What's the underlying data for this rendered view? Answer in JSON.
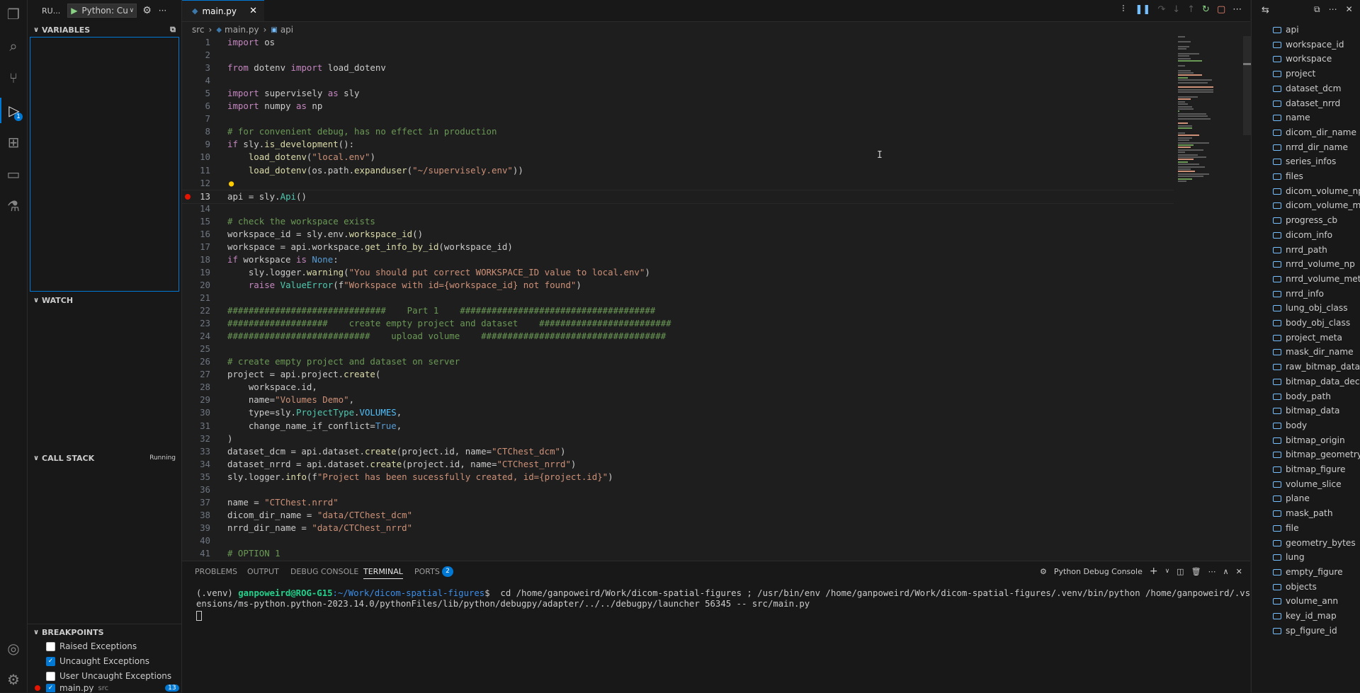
{
  "sidebar": {
    "run_label": "RU...",
    "config_label": "Python: Cu",
    "more": "···",
    "sections": {
      "variables": "VARIABLES",
      "watch": "WATCH",
      "call_stack": "CALL STACK",
      "call_stack_status": "Running",
      "breakpoints": "BREAKPOINTS"
    },
    "breakpoints": [
      {
        "label": "Raised Exceptions",
        "checked": false
      },
      {
        "label": "Uncaught Exceptions",
        "checked": true
      },
      {
        "label": "User Uncaught Exceptions",
        "checked": false
      }
    ],
    "bp_file": {
      "label": "main.py",
      "dir": "src",
      "line": "13"
    }
  },
  "activity": {
    "debug_badge": "1"
  },
  "editor": {
    "tab_label": "main.py",
    "breadcrumb": {
      "folder": "src",
      "file": "main.py",
      "symbol": "api"
    }
  },
  "code_lines": [
    {
      "n": "1",
      "t": "import os"
    },
    {
      "n": "2",
      "t": ""
    },
    {
      "n": "3",
      "t": "from dotenv import load_dotenv"
    },
    {
      "n": "4",
      "t": ""
    },
    {
      "n": "5",
      "t": "import supervisely as sly"
    },
    {
      "n": "6",
      "t": "import numpy as np"
    },
    {
      "n": "7",
      "t": ""
    },
    {
      "n": "8",
      "t": "# for convenient debug, has no effect in production"
    },
    {
      "n": "9",
      "t": "if sly.is_development():"
    },
    {
      "n": "10",
      "t": "    load_dotenv(\"local.env\")"
    },
    {
      "n": "11",
      "t": "    load_dotenv(os.path.expanduser(\"~/supervisely.env\"))"
    },
    {
      "n": "12",
      "t": ""
    },
    {
      "n": "13",
      "t": "api = sly.Api()"
    },
    {
      "n": "14",
      "t": ""
    },
    {
      "n": "15",
      "t": "# check the workspace exists"
    },
    {
      "n": "16",
      "t": "workspace_id = sly.env.workspace_id()"
    },
    {
      "n": "17",
      "t": "workspace = api.workspace.get_info_by_id(workspace_id)"
    },
    {
      "n": "18",
      "t": "if workspace is None:"
    },
    {
      "n": "19",
      "t": "    sly.logger.warning(\"You should put correct WORKSPACE_ID value to local.env\")"
    },
    {
      "n": "20",
      "t": "    raise ValueError(f\"Workspace with id={workspace_id} not found\")"
    },
    {
      "n": "21",
      "t": ""
    },
    {
      "n": "22",
      "t": "##############################    Part 1    #####################################"
    },
    {
      "n": "23",
      "t": "###################    create empty project and dataset    #########################"
    },
    {
      "n": "24",
      "t": "###########################    upload volume    ###################################"
    },
    {
      "n": "25",
      "t": ""
    },
    {
      "n": "26",
      "t": "# create empty project and dataset on server"
    },
    {
      "n": "27",
      "t": "project = api.project.create("
    },
    {
      "n": "28",
      "t": "    workspace.id,"
    },
    {
      "n": "29",
      "t": "    name=\"Volumes Demo\","
    },
    {
      "n": "30",
      "t": "    type=sly.ProjectType.VOLUMES,"
    },
    {
      "n": "31",
      "t": "    change_name_if_conflict=True,"
    },
    {
      "n": "32",
      "t": ")"
    },
    {
      "n": "33",
      "t": "dataset_dcm = api.dataset.create(project.id, name=\"CTChest_dcm\")"
    },
    {
      "n": "34",
      "t": "dataset_nrrd = api.dataset.create(project.id, name=\"CTChest_nrrd\")"
    },
    {
      "n": "35",
      "t": "sly.logger.info(f\"Project has been sucessfully created, id={project.id}\")"
    },
    {
      "n": "36",
      "t": ""
    },
    {
      "n": "37",
      "t": "name = \"CTChest.nrrd\""
    },
    {
      "n": "38",
      "t": "dicom_dir_name = \"data/CTChest_dcm\""
    },
    {
      "n": "39",
      "t": "nrrd_dir_name = \"data/CTChest_nrrd\""
    },
    {
      "n": "40",
      "t": ""
    },
    {
      "n": "41",
      "t": "# OPTION 1"
    }
  ],
  "panel": {
    "tabs": [
      "PROBLEMS",
      "OUTPUT",
      "DEBUG CONSOLE",
      "TERMINAL",
      "PORTS"
    ],
    "ports_badge": "2",
    "terminal_name": "Python Debug Console",
    "prompt_env": "(.venv) ",
    "prompt_user": "ganpoweird@ROG-G15",
    "prompt_path": ":~/Work/dicom-spatial-figures",
    "command_line1": "$  cd /home/ganpoweird/Work/dicom-spatial-figures ; /usr/bin/env /home/ganpoweird/Work/dicom-spatial-figures/.venv/bin/python /home/ganpoweird/.vscode-server/ext",
    "command_line2": "ensions/ms-python.python-2023.14.0/pythonFiles/lib/python/debugpy/adapter/../../debugpy/launcher 56345 -- src/main.py"
  },
  "outline": [
    "api",
    "workspace_id",
    "workspace",
    "project",
    "dataset_dcm",
    "dataset_nrrd",
    "name",
    "dicom_dir_name",
    "nrrd_dir_name",
    "series_infos",
    "files",
    "dicom_volume_np",
    "dicom_volume_meta",
    "progress_cb",
    "dicom_info",
    "nrrd_path",
    "nrrd_volume_np",
    "nrrd_volume_meta",
    "nrrd_info",
    "lung_obj_class",
    "body_obj_class",
    "project_meta",
    "mask_dir_name",
    "raw_bitmap_data",
    "bitmap_data_decoded",
    "body_path",
    "bitmap_data",
    "body",
    "bitmap_origin",
    "bitmap_geometry",
    "bitmap_figure",
    "volume_slice",
    "plane",
    "mask_path",
    "file",
    "geometry_bytes",
    "lung",
    "empty_figure",
    "objects",
    "volume_ann",
    "key_id_map",
    "sp_figure_id"
  ]
}
